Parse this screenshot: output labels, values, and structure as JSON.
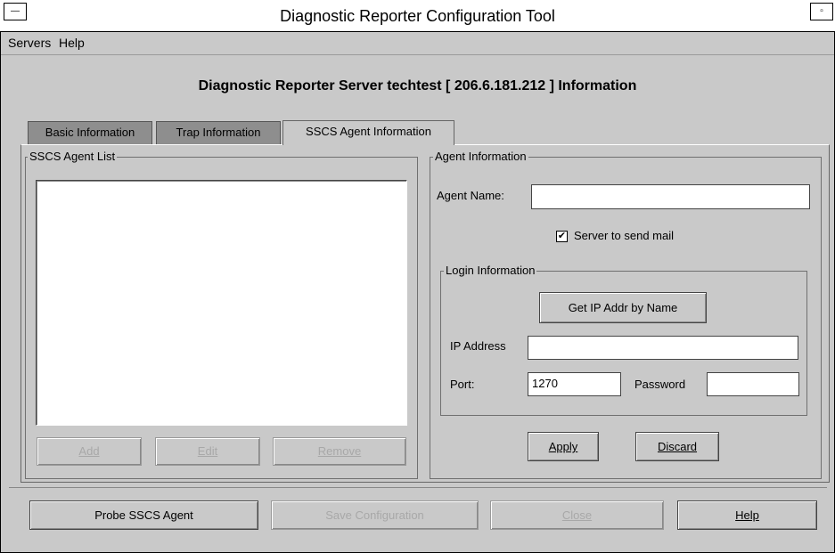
{
  "window": {
    "title": "Diagnostic Reporter Configuration Tool"
  },
  "menu": {
    "servers": "Servers",
    "help": "Help"
  },
  "heading": "Diagnostic Reporter Server techtest  [ 206.6.181.212 ]  Information",
  "tabs": {
    "basic": "Basic Information",
    "trap": "Trap Information",
    "sscs": "SSCS Agent Information"
  },
  "agent_list": {
    "title": "SSCS Agent List",
    "items": [],
    "add": "Add",
    "edit": "Edit",
    "remove": "Remove"
  },
  "agent_info": {
    "title": "Agent Information",
    "name_label": "Agent Name:",
    "name_value": "",
    "send_mail_label": "Server to send mail",
    "send_mail_checked": true,
    "login": {
      "title": "Login Information",
      "get_ip_button": "Get IP Addr by Name",
      "ip_label": "IP Address",
      "ip_value": "",
      "port_label": "Port:",
      "port_value": "1270",
      "password_label": "Password",
      "password_value": ""
    },
    "apply": "Apply",
    "discard": "Discard"
  },
  "bottom_buttons": {
    "probe": "Probe SSCS Agent",
    "save": "Save Configuration",
    "close": "Close",
    "help": "Help"
  },
  "icons": {
    "window_menu": "window-menu-icon",
    "minimize": "minimize-icon",
    "checkmark": "checkmark-icon"
  }
}
